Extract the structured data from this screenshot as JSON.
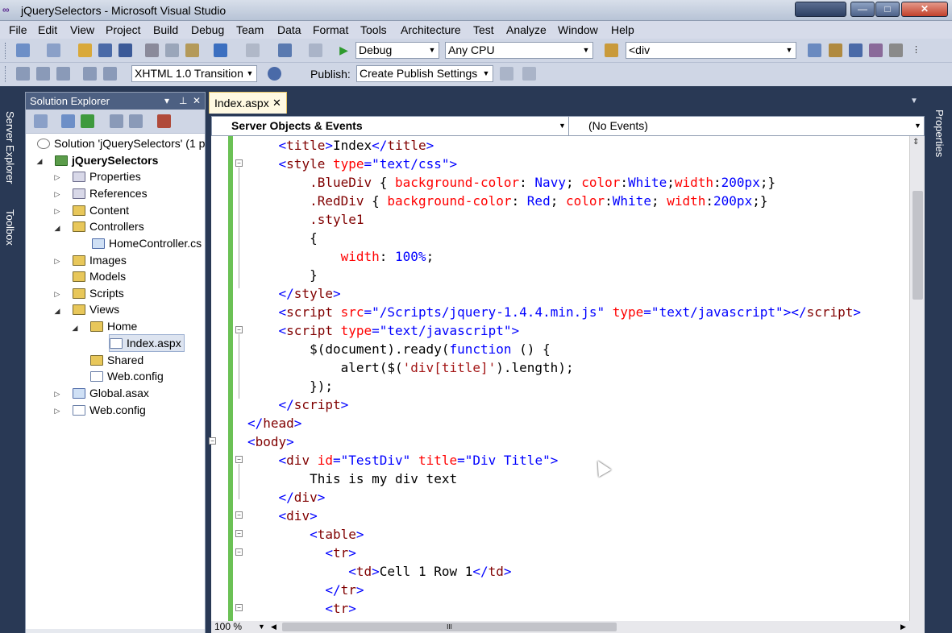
{
  "window": {
    "title": "jQuerySelectors - Microsoft Visual Studio",
    "app_icon": "∞"
  },
  "menu": [
    "File",
    "Edit",
    "View",
    "Project",
    "Build",
    "Debug",
    "Team",
    "Data",
    "Format",
    "Tools",
    "Architecture",
    "Test",
    "Analyze",
    "Window",
    "Help"
  ],
  "toolbar": {
    "config": "Debug",
    "platform": "Any CPU",
    "find": "<div",
    "doctype": "XHTML 1.0 Transition",
    "publish_label": "Publish:",
    "publish_settings": "Create Publish Settings"
  },
  "side_tabs": {
    "server_explorer": "Server Explorer",
    "toolbox": "Toolbox",
    "properties": "Properties"
  },
  "solution_explorer": {
    "title": "Solution Explorer",
    "items": [
      {
        "label": "Solution 'jQuerySelectors' (1 p",
        "icon": "solution-icon"
      },
      {
        "label": "jQuerySelectors",
        "icon": "project-icon"
      },
      {
        "label": "Properties",
        "icon": "properties-icon"
      },
      {
        "label": "References",
        "icon": "references-icon"
      },
      {
        "label": "Content",
        "icon": "folder-icon"
      },
      {
        "label": "Controllers",
        "icon": "folder-icon"
      },
      {
        "label": "HomeController.cs",
        "icon": "csharp-file-icon"
      },
      {
        "label": "Images",
        "icon": "folder-icon"
      },
      {
        "label": "Models",
        "icon": "folder-icon"
      },
      {
        "label": "Scripts",
        "icon": "folder-icon"
      },
      {
        "label": "Views",
        "icon": "folder-icon"
      },
      {
        "label": "Home",
        "icon": "open-folder-icon"
      },
      {
        "label": "Index.aspx",
        "icon": "aspx-file-icon"
      },
      {
        "label": "Shared",
        "icon": "folder-icon"
      },
      {
        "label": "Web.config",
        "icon": "config-file-icon"
      },
      {
        "label": "Global.asax",
        "icon": "asax-file-icon"
      },
      {
        "label": "Web.config",
        "icon": "config-file-icon"
      }
    ]
  },
  "editor": {
    "tab": "Index.aspx",
    "nav_left": "Server Objects & Events",
    "nav_right": "(No Events)",
    "zoom": "100 %",
    "lines": [
      [
        [
          "tg",
          "    "
        ],
        [
          "br",
          "<"
        ],
        [
          "tg",
          "title"
        ],
        [
          "br",
          ">"
        ],
        [
          "tx",
          "Index"
        ],
        [
          "br",
          "</"
        ],
        [
          "tg",
          "title"
        ],
        [
          "br",
          ">"
        ]
      ],
      [
        [
          "tx",
          "    "
        ],
        [
          "br",
          "<"
        ],
        [
          "tg",
          "style "
        ],
        [
          "at",
          "type"
        ],
        [
          "br",
          "=\"text/css\">"
        ]
      ],
      [
        [
          "tx",
          "        "
        ],
        [
          "tg",
          ".BlueDiv"
        ],
        [
          "tx",
          " { "
        ],
        [
          "at",
          "background-color"
        ],
        [
          "tx",
          ": "
        ],
        [
          "av",
          "Navy"
        ],
        [
          "tx",
          "; "
        ],
        [
          "at",
          "color"
        ],
        [
          "tx",
          ":"
        ],
        [
          "av",
          "White"
        ],
        [
          "tx",
          ";"
        ],
        [
          "at",
          "width"
        ],
        [
          "tx",
          ":"
        ],
        [
          "av",
          "200px"
        ],
        [
          "tx",
          ";}"
        ]
      ],
      [
        [
          "tx",
          "        "
        ],
        [
          "tg",
          ".RedDiv"
        ],
        [
          "tx",
          " { "
        ],
        [
          "at",
          "background-color"
        ],
        [
          "tx",
          ": "
        ],
        [
          "av",
          "Red"
        ],
        [
          "tx",
          "; "
        ],
        [
          "at",
          "color"
        ],
        [
          "tx",
          ":"
        ],
        [
          "av",
          "White"
        ],
        [
          "tx",
          "; "
        ],
        [
          "at",
          "width"
        ],
        [
          "tx",
          ":"
        ],
        [
          "av",
          "200px"
        ],
        [
          "tx",
          ";}"
        ]
      ],
      [
        [
          "tx",
          "        "
        ],
        [
          "tg",
          ".style1"
        ]
      ],
      [
        [
          "tx",
          "        {"
        ]
      ],
      [
        [
          "tx",
          "            "
        ],
        [
          "at",
          "width"
        ],
        [
          "tx",
          ": "
        ],
        [
          "av",
          "100%"
        ],
        [
          "tx",
          ";"
        ]
      ],
      [
        [
          "tx",
          "        }"
        ]
      ],
      [
        [
          "tx",
          "    "
        ],
        [
          "br",
          "</"
        ],
        [
          "tg",
          "style"
        ],
        [
          "br",
          ">"
        ]
      ],
      [
        [
          "tx",
          "    "
        ],
        [
          "br",
          "<"
        ],
        [
          "tg",
          "script "
        ],
        [
          "at",
          "src"
        ],
        [
          "br",
          "=\"/Scripts/jquery-1.4.4.min.js\" "
        ],
        [
          "at",
          "type"
        ],
        [
          "br",
          "=\"text/javascript\"></"
        ],
        [
          "tg",
          "script"
        ],
        [
          "br",
          ">"
        ]
      ],
      [
        [
          "tx",
          "    "
        ],
        [
          "br",
          "<"
        ],
        [
          "tg",
          "script "
        ],
        [
          "at",
          "type"
        ],
        [
          "br",
          "=\"text/javascript\">"
        ]
      ],
      [
        [
          "tx",
          "        $(document).ready("
        ],
        [
          "kw",
          "function"
        ],
        [
          "tx",
          " () {"
        ]
      ],
      [
        [
          "tx",
          "            alert($("
        ],
        [
          "st",
          "'div[title]'"
        ],
        [
          "tx",
          ").length);"
        ]
      ],
      [
        [
          "tx",
          "        });"
        ]
      ],
      [
        [
          "tx",
          "    "
        ],
        [
          "br",
          "</"
        ],
        [
          "tg",
          "script"
        ],
        [
          "br",
          ">"
        ]
      ],
      [
        [
          "br",
          "</"
        ],
        [
          "tg",
          "head"
        ],
        [
          "br",
          ">"
        ]
      ],
      [
        [
          "br",
          "<"
        ],
        [
          "tg",
          "body"
        ],
        [
          "br",
          ">"
        ]
      ],
      [
        [
          "tx",
          "    "
        ],
        [
          "br",
          "<"
        ],
        [
          "tg",
          "div "
        ],
        [
          "at",
          "id"
        ],
        [
          "br",
          "=\"TestDiv\" "
        ],
        [
          "at",
          "title"
        ],
        [
          "br",
          "=\"Div Title\">"
        ]
      ],
      [
        [
          "tx",
          "        This is my div text"
        ]
      ],
      [
        [
          "tx",
          "    "
        ],
        [
          "br",
          "</"
        ],
        [
          "tg",
          "div"
        ],
        [
          "br",
          ">"
        ]
      ],
      [
        [
          "tx",
          "    "
        ],
        [
          "br",
          "<"
        ],
        [
          "tg",
          "div"
        ],
        [
          "br",
          ">"
        ]
      ],
      [
        [
          "tx",
          "        "
        ],
        [
          "br",
          "<"
        ],
        [
          "tg",
          "table"
        ],
        [
          "br",
          ">"
        ]
      ],
      [
        [
          "tx",
          "          "
        ],
        [
          "br",
          "<"
        ],
        [
          "tg",
          "tr"
        ],
        [
          "br",
          ">"
        ]
      ],
      [
        [
          "tx",
          "             "
        ],
        [
          "br",
          "<"
        ],
        [
          "tg",
          "td"
        ],
        [
          "br",
          ">"
        ],
        [
          "tx",
          "Cell 1 Row 1"
        ],
        [
          "br",
          "</"
        ],
        [
          "tg",
          "td"
        ],
        [
          "br",
          ">"
        ]
      ],
      [
        [
          "tx",
          "          "
        ],
        [
          "br",
          "</"
        ],
        [
          "tg",
          "tr"
        ],
        [
          "br",
          ">"
        ]
      ],
      [
        [
          "tx",
          "          "
        ],
        [
          "br",
          "<"
        ],
        [
          "tg",
          "tr"
        ],
        [
          "br",
          ">"
        ]
      ]
    ]
  }
}
